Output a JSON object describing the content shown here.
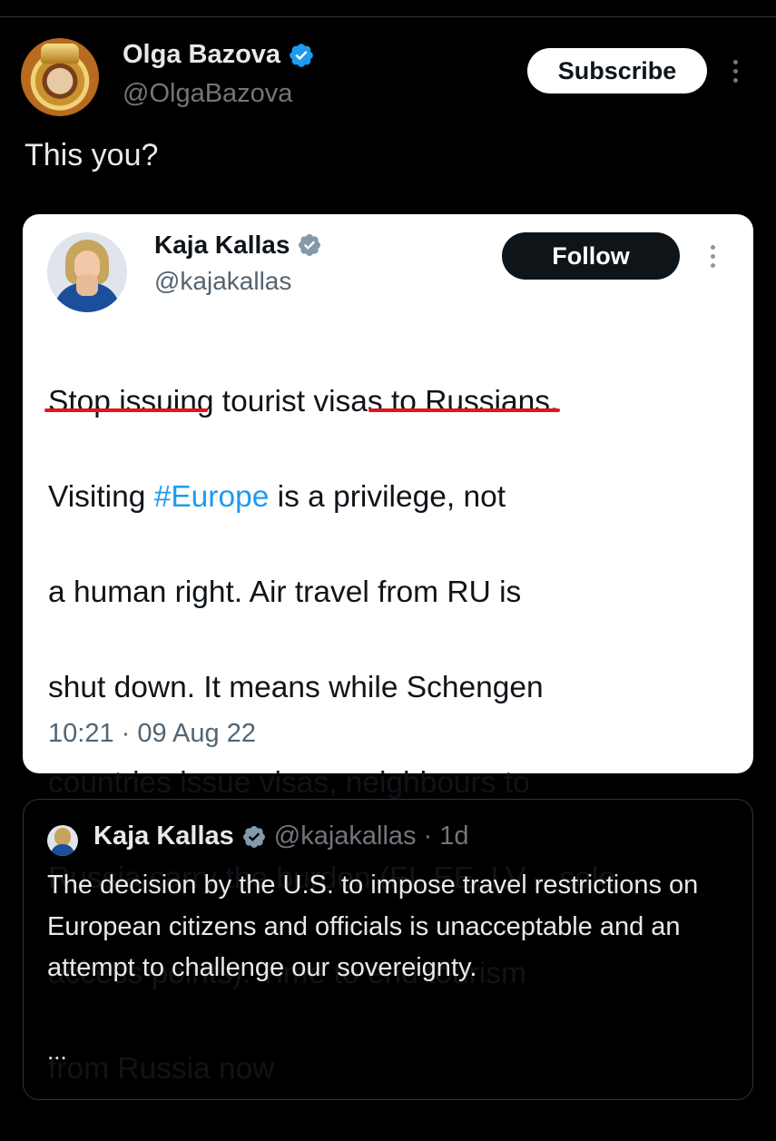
{
  "author": {
    "name": "Olga Bazova",
    "handle": "@OlgaBazova",
    "subscribe_label": "Subscribe"
  },
  "tweet": {
    "text": "This you?"
  },
  "embedded_tweet": {
    "name": "Kaja Kallas",
    "handle": "@kajakallas",
    "follow_label": "Follow",
    "lines": [
      "Stop issuing tourist visas to Russians.",
      "a human right. Air travel from RU is",
      "shut down. It means while Schengen",
      "countries issue visas, neighbours to",
      "Russia carry the burden (FI, EE, LV – sole",
      "access points). Time to end tourism",
      "from Russia now"
    ],
    "line2": {
      "part1": "Visiting ",
      "hashtag": "#Europe",
      "part2": " is a privilege, not"
    },
    "timestamp": "10:21 · 09 Aug 22",
    "accent_color": "#1d9bf0",
    "underline_color": "#e0161b"
  },
  "quoted_tweet": {
    "name": "Kaja Kallas",
    "handle": "@kajakallas",
    "age": "· 1d",
    "text": "The decision by the U.S. to impose travel restrictions on European citizens and officials is unacceptable and an attempt to challenge our sovereignty.",
    "ellipsis": "..."
  },
  "icons": [
    "verified-badge-icon",
    "more-options-icon"
  ]
}
